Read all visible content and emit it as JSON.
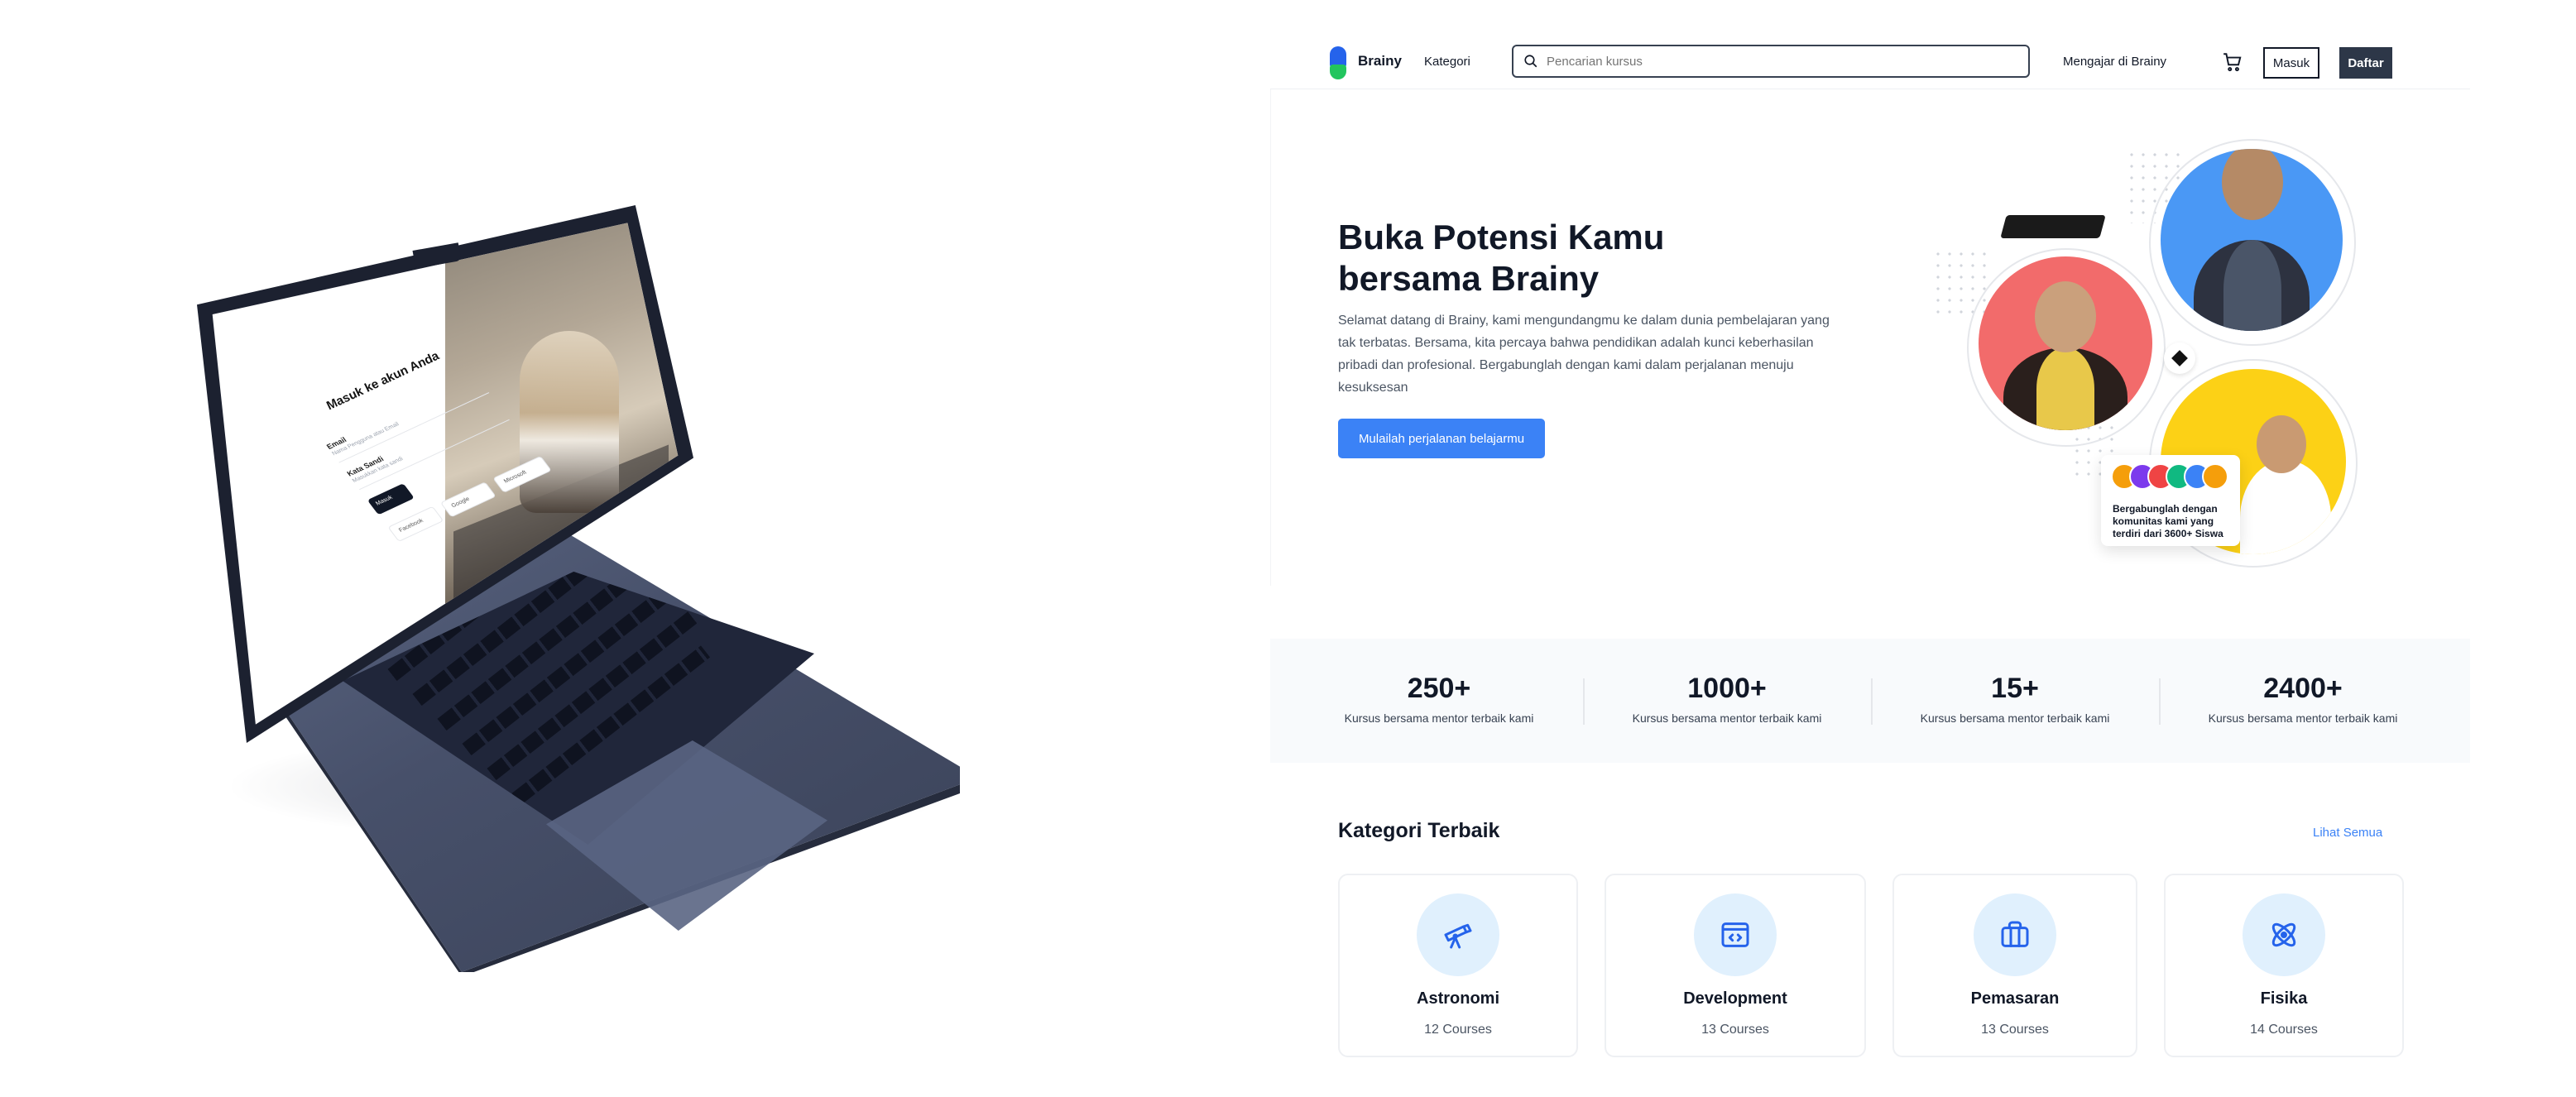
{
  "nav": {
    "brand": "Brainy",
    "kategori": "Kategori",
    "search_placeholder": "Pencarian kursus",
    "teach": "Mengajar di Brainy",
    "login": "Masuk",
    "register": "Daftar"
  },
  "hero": {
    "title": "Buka Potensi Kamu bersama Brainy",
    "description": "Selamat datang di Brainy, kami mengundangmu ke dalam dunia pembelajaran yang tak terbatas. Bersama, kita percaya bahwa pendidikan adalah kunci keberhasilan pribadi dan profesional. Bergabunglah dengan kami dalam perjalanan menuju kesuksesan",
    "cta": "Mulailah perjalanan belajarmu",
    "community": "Bergabunglah dengan komunitas kami yang terdiri dari 3600+ Siswa"
  },
  "stats": [
    {
      "value": "250+",
      "label": "Kursus bersama mentor terbaik kami"
    },
    {
      "value": "1000+",
      "label": "Kursus bersama mentor terbaik kami"
    },
    {
      "value": "15+",
      "label": "Kursus bersama mentor terbaik kami"
    },
    {
      "value": "2400+",
      "label": "Kursus bersama mentor terbaik kami"
    }
  ],
  "categories": {
    "title": "Kategori Terbaik",
    "see_all": "Lihat Semua",
    "items": [
      {
        "name": "Astronomi",
        "count": "12 Courses",
        "icon": "telescope-icon"
      },
      {
        "name": "Development",
        "count": "13 Courses",
        "icon": "code-window-icon"
      },
      {
        "name": "Pemasaran",
        "count": "13 Courses",
        "icon": "briefcase-icon"
      },
      {
        "name": "Fisika",
        "count": "14 Courses",
        "icon": "atom-icon"
      }
    ]
  },
  "laptop_screen": {
    "title": "Masuk ke akun Anda",
    "email_label": "Email",
    "email_placeholder": "Nama Pengguna atau Email",
    "password_label": "Kata Sandi",
    "password_placeholder": "Masukkan kata sandi",
    "submit": "Masuk",
    "facebook": "Facebook",
    "google": "Google",
    "microsoft": "Microsoft"
  },
  "colors": {
    "primary": "#3b82f6",
    "dark_button": "#2d3748",
    "icon_bg": "#e0f0fd",
    "stats_bg": "#f8fafc"
  }
}
